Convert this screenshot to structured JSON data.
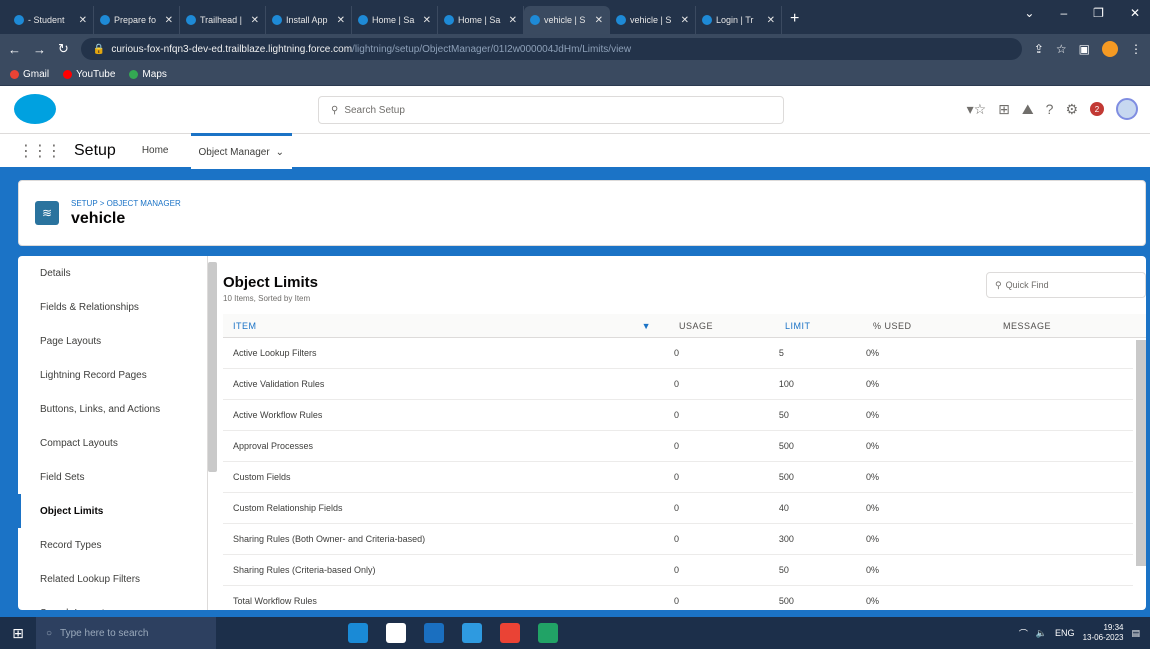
{
  "browser": {
    "tabs": [
      {
        "title": "- Student"
      },
      {
        "title": "Prepare fo"
      },
      {
        "title": "Trailhead |"
      },
      {
        "title": "Install App"
      },
      {
        "title": "Home | Sa"
      },
      {
        "title": "Home | Sa"
      },
      {
        "title": "vehicle | S"
      },
      {
        "title": "vehicle | S"
      },
      {
        "title": "Login | Tr"
      }
    ],
    "active_tab_index": 6,
    "new_tab": "+",
    "url_host": "curious-fox-nfqn3-dev-ed.trailblaze.lightning.force.com",
    "url_path": "/lightning/setup/ObjectManager/01I2w000004JdHm/Limits/view",
    "bookmarks": [
      {
        "label": "Gmail",
        "color": "#ea4335"
      },
      {
        "label": "YouTube",
        "color": "#ff0000"
      },
      {
        "label": "Maps",
        "color": "#34a853"
      }
    ]
  },
  "sf": {
    "search_placeholder": "Search Setup",
    "app_title": "Setup",
    "nav_home": "Home",
    "nav_object_manager": "Object Manager",
    "breadcrumb": "SETUP > OBJECT MANAGER",
    "object_name": "vehicle",
    "notification_count": "2"
  },
  "sidebar": {
    "items": [
      {
        "label": "Details"
      },
      {
        "label": "Fields & Relationships"
      },
      {
        "label": "Page Layouts"
      },
      {
        "label": "Lightning Record Pages"
      },
      {
        "label": "Buttons, Links, and Actions"
      },
      {
        "label": "Compact Layouts"
      },
      {
        "label": "Field Sets"
      },
      {
        "label": "Object Limits"
      },
      {
        "label": "Record Types"
      },
      {
        "label": "Related Lookup Filters"
      },
      {
        "label": "Search Layouts"
      }
    ],
    "active_index": 7
  },
  "limits": {
    "title": "Object Limits",
    "subtitle": "10 Items, Sorted by Item",
    "quick_find_placeholder": "Quick Find",
    "columns": [
      "ITEM",
      "USAGE",
      "LIMIT",
      "% USED",
      "MESSAGE"
    ],
    "sort_indicator": "▼",
    "rows": [
      {
        "item": "Active Lookup Filters",
        "usage": "0",
        "limit": "5",
        "used": "0%"
      },
      {
        "item": "Active Validation Rules",
        "usage": "0",
        "limit": "100",
        "used": "0%"
      },
      {
        "item": "Active Workflow Rules",
        "usage": "0",
        "limit": "50",
        "used": "0%"
      },
      {
        "item": "Approval Processes",
        "usage": "0",
        "limit": "500",
        "used": "0%"
      },
      {
        "item": "Custom Fields",
        "usage": "0",
        "limit": "500",
        "used": "0%"
      },
      {
        "item": "Custom Relationship Fields",
        "usage": "0",
        "limit": "40",
        "used": "0%"
      },
      {
        "item": "Sharing Rules (Both Owner- and Criteria-based)",
        "usage": "0",
        "limit": "300",
        "used": "0%"
      },
      {
        "item": "Sharing Rules (Criteria-based Only)",
        "usage": "0",
        "limit": "50",
        "used": "0%"
      },
      {
        "item": "Total Workflow Rules",
        "usage": "0",
        "limit": "500",
        "used": "0%"
      }
    ]
  },
  "taskbar": {
    "search_placeholder": "Type here to search",
    "time": "19:34",
    "date": "13-06-2023",
    "lang": "ENG"
  }
}
